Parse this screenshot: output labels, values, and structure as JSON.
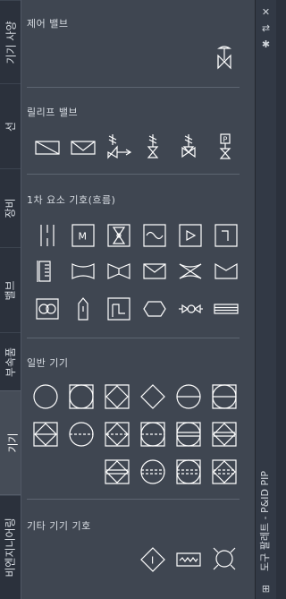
{
  "tabs": [
    {
      "label": "기기 사양",
      "active": false
    },
    {
      "label": "선",
      "active": false
    },
    {
      "label": "장비",
      "active": false
    },
    {
      "label": "밸브",
      "active": false
    },
    {
      "label": "부속품",
      "active": false
    },
    {
      "label": "기기",
      "active": true
    },
    {
      "label": "비엔지니어링",
      "active": false
    }
  ],
  "sections": {
    "control_valve": "제어 밸브",
    "relief_valve": "릴리프 밸브",
    "primary_element": "1차 요소 기호(흐름)",
    "general_instrument": "일반 기기",
    "misc_instrument": "기타 기기 기호"
  },
  "icons": {
    "flow_meter_m_label": "M",
    "misc_diamond_label": "I",
    "relief_5_label": "P"
  },
  "rail": {
    "title": "도구 팔레트 - P&ID PIP",
    "close_glyph": "✕",
    "autohide_glyph": "⇄",
    "properties_glyph": "✱",
    "bottom_glyph": "⊞"
  },
  "colors": {
    "background": "#2b313c",
    "panel": "#3f4651",
    "icon_stroke": "#ffffff"
  }
}
